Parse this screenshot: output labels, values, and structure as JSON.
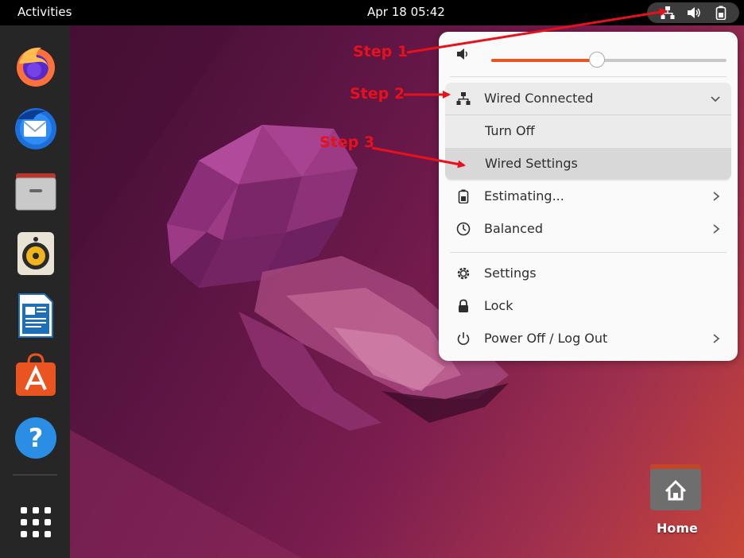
{
  "topbar": {
    "activities": "Activities",
    "clock": "Apr 18  05:42",
    "tray_icons": [
      "network-wired-icon",
      "speaker-icon",
      "battery-icon"
    ]
  },
  "dock": {
    "apps": [
      "firefox-icon",
      "thunderbird-icon",
      "files-icon",
      "rhythmbox-icon",
      "libreoffice-writer-icon",
      "software-center-icon",
      "help-icon",
      "show-apps-icon"
    ]
  },
  "menu": {
    "volume_level": 0.45,
    "wired": {
      "label": "Wired Connected",
      "turn_off": "Turn Off",
      "settings": "Wired Settings"
    },
    "battery": "Estimating...",
    "power_mode": "Balanced",
    "settings": "Settings",
    "lock": "Lock",
    "power": "Power Off / Log Out"
  },
  "annotations": {
    "step1": "Step 1",
    "step2": "Step 2",
    "step3": "Step 3"
  },
  "desktop": {
    "home_label": "Home"
  },
  "colors": {
    "accent": "#e95420",
    "annotation": "#e8101a",
    "menu_bg": "#fafafa"
  }
}
